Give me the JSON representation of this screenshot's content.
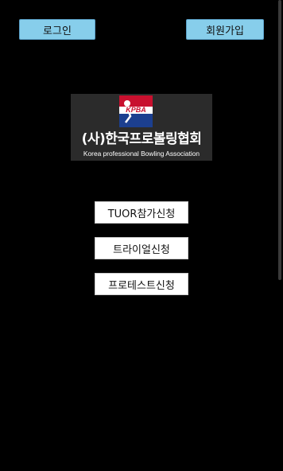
{
  "header": {
    "login_label": "로그인",
    "signup_label": "회원가입"
  },
  "logo": {
    "emblem_text": "KPBA",
    "name_ko": "(사)한국프로볼링협회",
    "name_en": "Korea professional Bowling Association",
    "emblem_colors": {
      "red": "#c8102e",
      "blue": "#1c3f8f"
    }
  },
  "menu": [
    {
      "label": "TUOR참가신청"
    },
    {
      "label": "트라이얼신청"
    },
    {
      "label": "프로테스트신청"
    }
  ],
  "colors": {
    "background": "#000000",
    "top_button": "#87ceeb",
    "menu_button": "#ffffff"
  }
}
